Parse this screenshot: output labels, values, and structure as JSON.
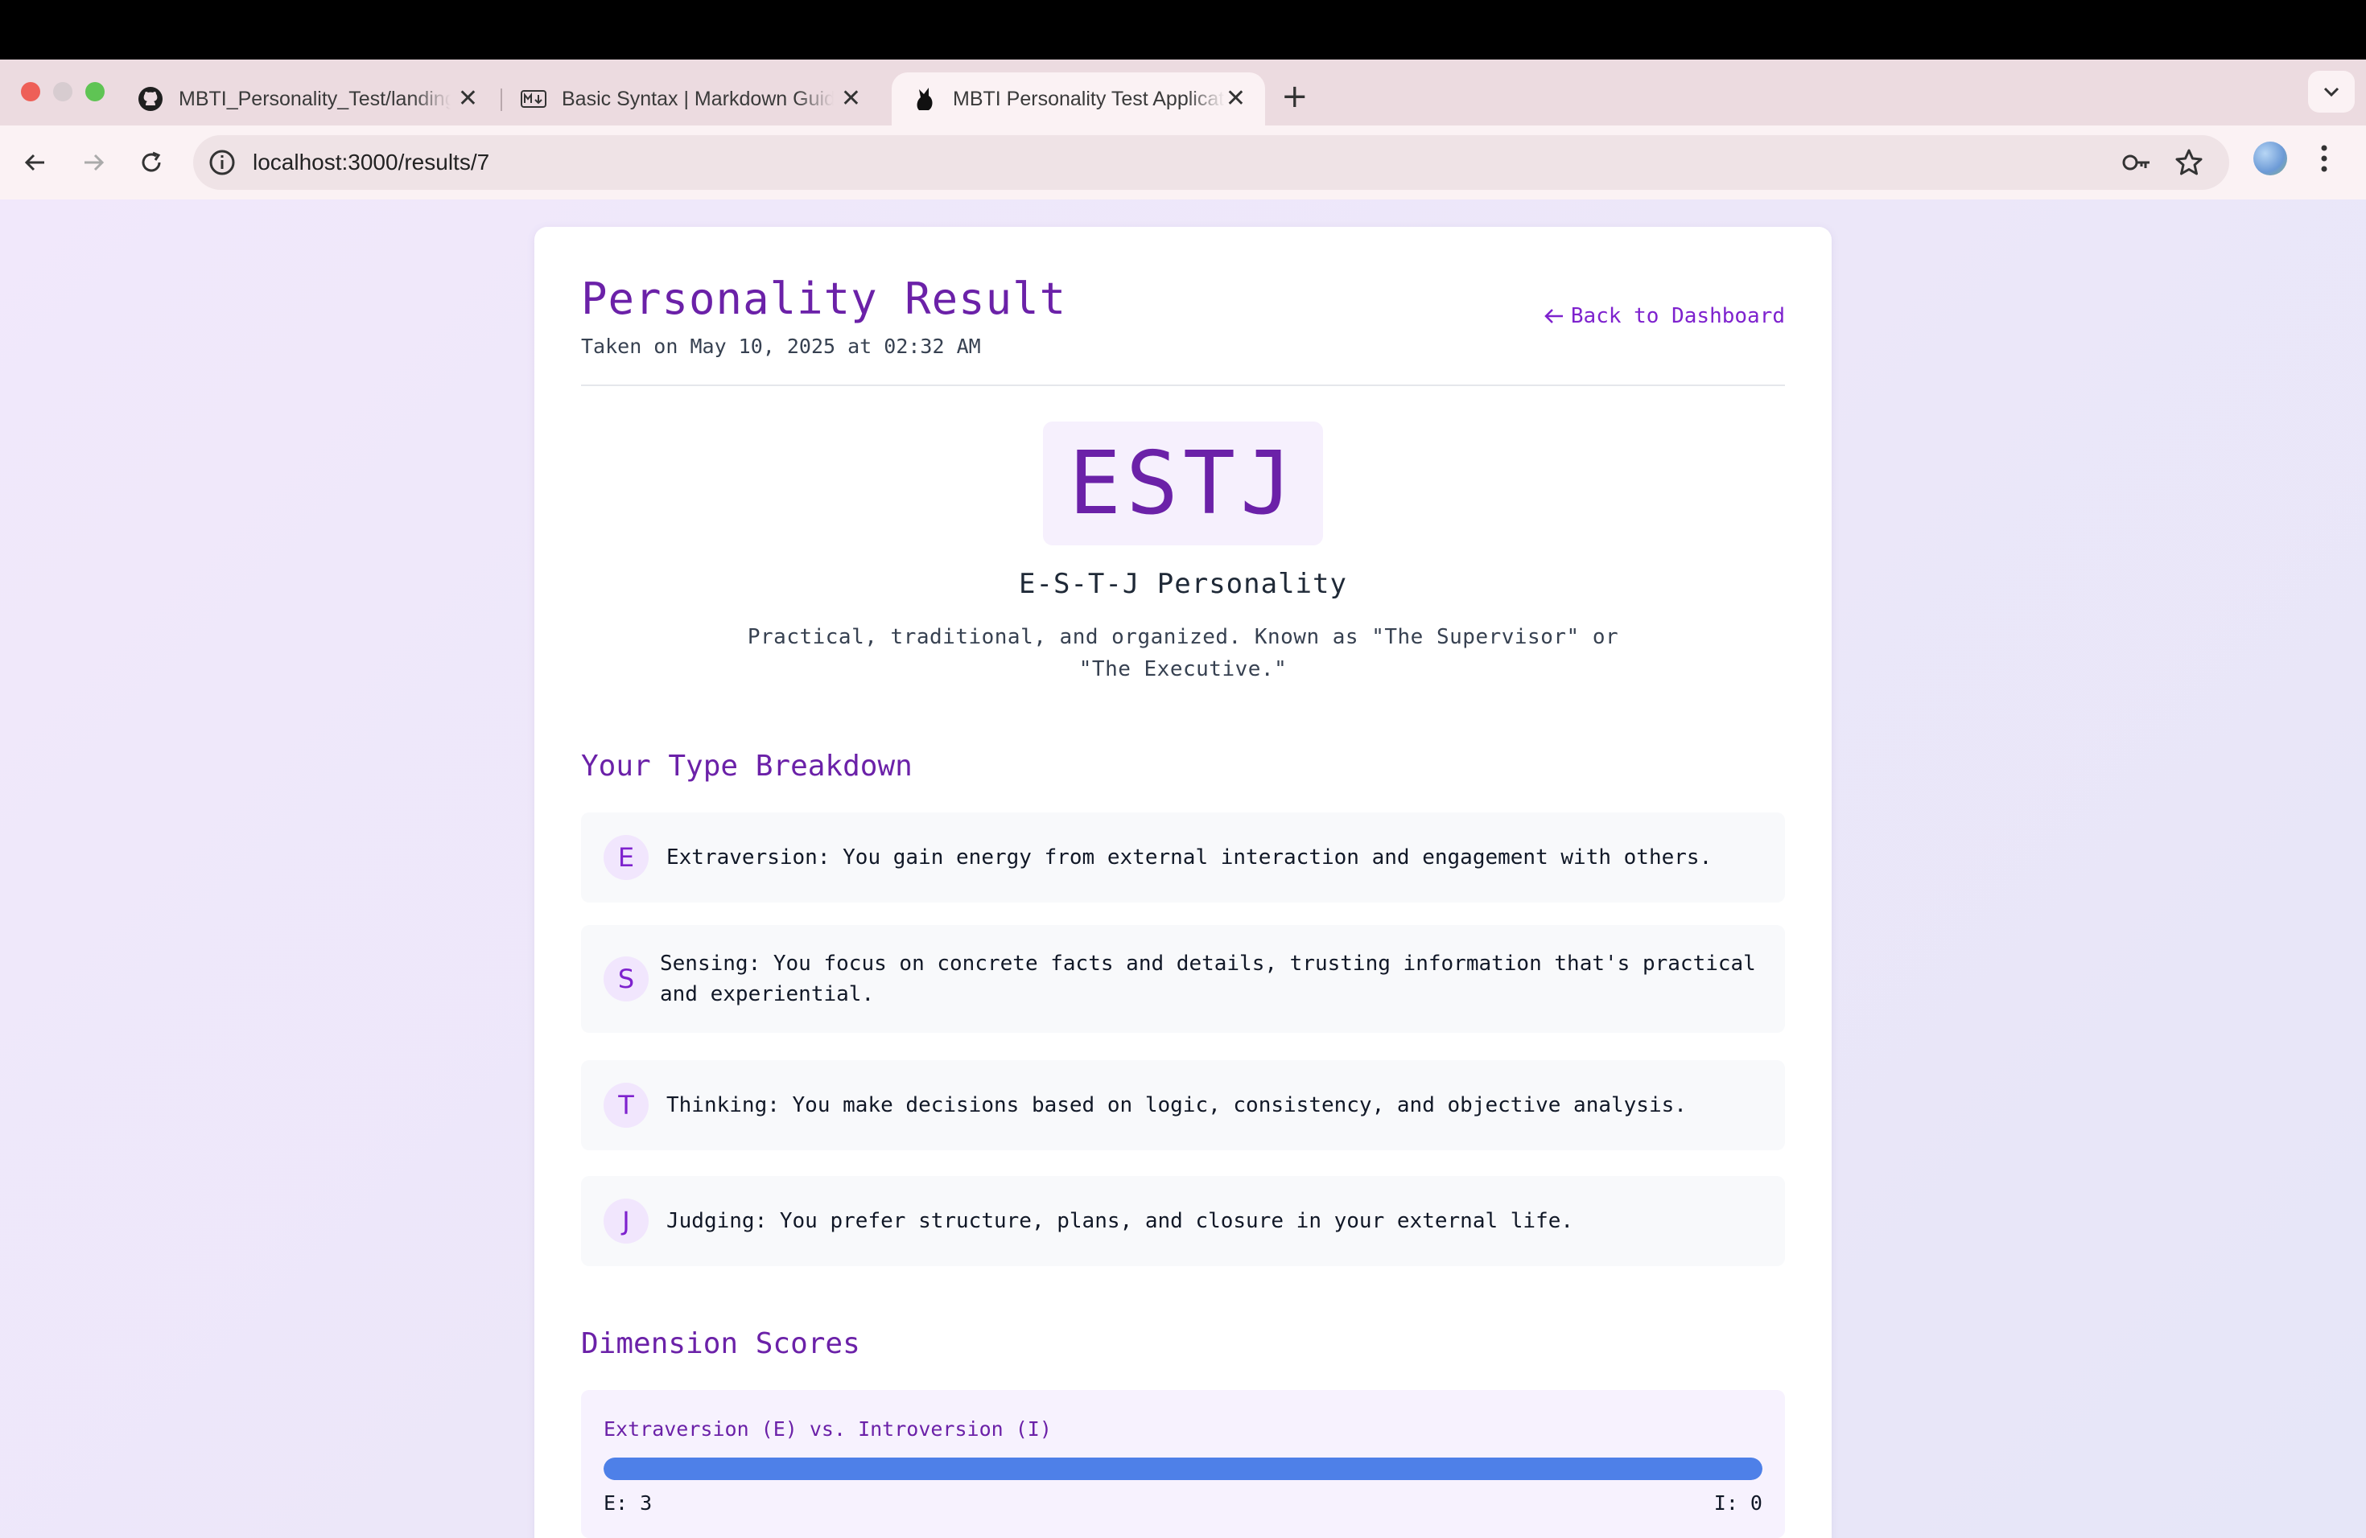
{
  "browser": {
    "tabs": [
      {
        "title": "MBTI_Personality_Test/landing",
        "icon": "github-icon"
      },
      {
        "title": "Basic Syntax | Markdown Guide",
        "icon": "markdown-icon"
      },
      {
        "title": "MBTI Personality Test Application",
        "icon": "app-icon"
      }
    ],
    "url": "localhost:3000/results/7"
  },
  "header": {
    "title": "Personality Result",
    "taken": "Taken on May 10, 2025 at 02:32 AM",
    "back_label": "Back to Dashboard"
  },
  "result": {
    "type": "ESTJ",
    "type_name": "E-S-T-J Personality",
    "description": "Practical, traditional, and organized. Known as \"The Supervisor\" or \"The Executive.\""
  },
  "breakdown": {
    "heading": "Your Type Breakdown",
    "items": [
      {
        "letter": "E",
        "text": "Extraversion: You gain energy from external interaction and engagement with others."
      },
      {
        "letter": "S",
        "text": "Sensing: You focus on concrete facts and details, trusting information that's practical and experiential."
      },
      {
        "letter": "T",
        "text": "Thinking: You make decisions based on logic, consistency, and objective analysis."
      },
      {
        "letter": "J",
        "text": "Judging: You prefer structure, plans, and closure in your external life."
      }
    ]
  },
  "scores": {
    "heading": "Dimension Scores",
    "items": [
      {
        "label": "Extraversion (E) vs. Introversion (I)",
        "left": "E: 3",
        "right": "I: 0",
        "fill_fraction": 1.0
      }
    ]
  },
  "colors": {
    "accent": "#6b21a8",
    "bar": "#4e80e8"
  }
}
